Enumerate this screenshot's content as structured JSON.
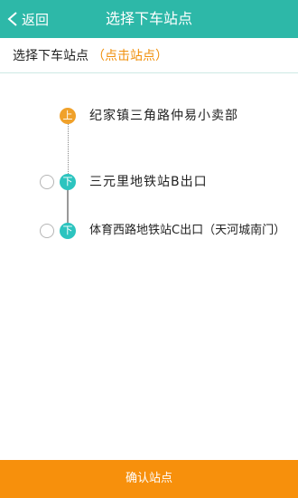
{
  "header": {
    "back_label": "返回",
    "title": "选择下车站点"
  },
  "subheader": {
    "label": "选择下车站点",
    "hint": "（点击站点）"
  },
  "stops": [
    {
      "badge": "上",
      "name": "纪家镇三角路仲易小卖部"
    },
    {
      "badge": "下",
      "name": "三元里地铁站B出口"
    },
    {
      "badge": "下",
      "name": "体育西路地铁站C出口（天河城南门）"
    }
  ],
  "footer": {
    "confirm_label": "确认站点"
  },
  "colors": {
    "header": "#2db8a8",
    "board_badge": "#f0a12a",
    "alight_badge": "#2cc4bf",
    "footer": "#f7900c",
    "hint": "#f0900c"
  }
}
